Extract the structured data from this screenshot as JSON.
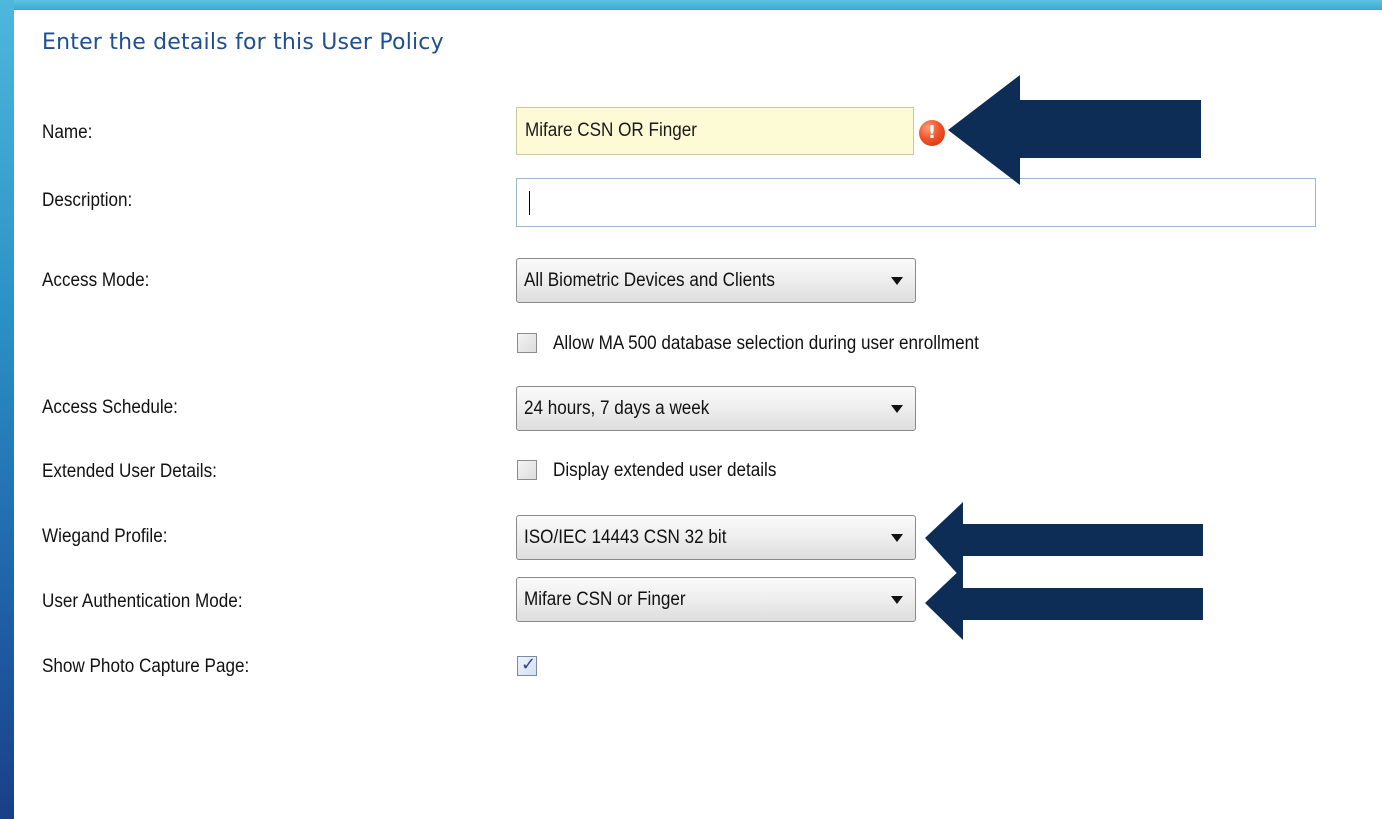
{
  "heading": "Enter the details for this User Policy",
  "fields": {
    "name": {
      "label": "Name:",
      "value": "Mifare CSN OR Finger",
      "error_icon": "!"
    },
    "description": {
      "label": "Description:",
      "value": ""
    },
    "access_mode": {
      "label": "Access Mode:",
      "selected": "All Biometric Devices and Clients",
      "checkbox_label": "Allow MA 500 database selection during user enrollment",
      "checkbox_checked": false
    },
    "access_schedule": {
      "label": "Access Schedule:",
      "selected": "24 hours, 7 days a week"
    },
    "extended_user_details": {
      "label": "Extended User Details:",
      "checkbox_label": "Display extended user details",
      "checkbox_checked": false
    },
    "wiegand_profile": {
      "label": "Wiegand Profile:",
      "selected": "ISO/IEC 14443 CSN 32 bit"
    },
    "user_authentication_mode": {
      "label": "User Authentication Mode:",
      "selected": "Mifare CSN or Finger"
    },
    "show_photo_capture_page": {
      "label": "Show Photo Capture Page:",
      "checked": true,
      "check_glyph": "✓"
    }
  },
  "colors": {
    "heading": "#1d4f91",
    "callout_arrow": "#0d2d57",
    "invalid_field_bg": "#fdfbd6",
    "error_icon": "#e8451e",
    "frame_accent": "#3da9cf"
  },
  "icons": {
    "error": "error-icon",
    "dropdown": "chevron-down-icon",
    "callout": "arrow-left-icon"
  }
}
